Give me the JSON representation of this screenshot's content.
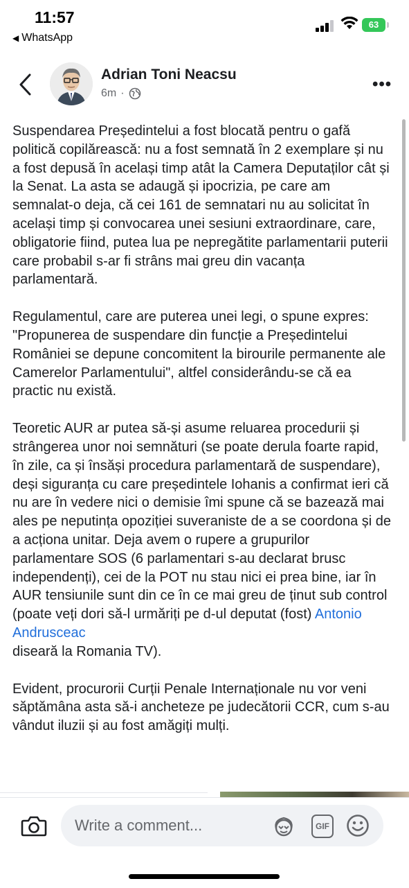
{
  "status_bar": {
    "time": "11:57",
    "back_app": "WhatsApp",
    "battery": "63",
    "battery_color": "#34c759"
  },
  "post": {
    "author": "Adrian Toni Neacsu",
    "time_ago": "6m",
    "separator": "·",
    "audience_icon": "globe-icon",
    "more_icon": "more-dots-icon",
    "more_glyph": "•••",
    "paragraphs": [
      {
        "text": "Suspendarea Președintelui a fost blocată pentru o gafă politică copilărească: nu a fost semnată în 2 exemplare și nu a fost depusă în același timp atât la Camera Deputaților cât și la Senat.  La asta se adaugă și ipocrizia, pe care am semnalat-o deja, că cei 161 de semnatari nu au solicitat în același timp și convocarea unei sesiuni extraordinare, care, obligatorie fiind, putea lua pe nepregătite parlamentarii puterii care probabil s-ar fi strâns mai greu din vacanța parlamentară."
      },
      {
        "text": "Regulamentul, care are puterea unei legi, o spune expres: \"Propunerea de suspendare din funcție a Președintelui României se depune concomitent la birourile permanente ale Camerelor Parlamentului\", altfel considerându-se că ea practic nu există."
      },
      {
        "text_before": "Teoretic AUR ar putea să-și asume reluarea procedurii și strângerea unor noi semnături (se poate derula foarte rapid, în zile, ca și însăși procedura parlamentară de suspendare), deși siguranța cu care președintele Iohanis a confirmat ieri că nu are în vedere nici o demisie îmi spune că se bazează mai ales pe  neputința opoziției suveraniste de a se coordona și de a acționa unitar. Deja avem o rupere a grupurilor parlamentare SOS (6 parlamentari s-au declarat brusc independenți), cei de la POT nu stau nici ei prea bine, iar în AUR tensiunile sunt din ce în ce mai greu de ținut sub control (poate veți dori să-l urmăriți pe d-ul deputat (fost) ",
        "mention": "Antonio Andrusceac",
        "text_after": "\ndiseară la Romania TV)."
      },
      {
        "text": "Evident, procurorii Curții Penale Internaționale nu vor veni săptămâna asta să-i ancheteze pe judecătorii CCR, cum s-au vândut iluzii și au fost amăgiți mulți."
      }
    ],
    "mention_color": "#216fdb"
  },
  "comment_bar": {
    "placeholder": "Write a comment...",
    "camera_icon": "camera-icon",
    "avatar_sticker_icon": "avatar-sticker-icon",
    "gif_label": "GIF",
    "emoji_icon": "emoji-icon"
  }
}
